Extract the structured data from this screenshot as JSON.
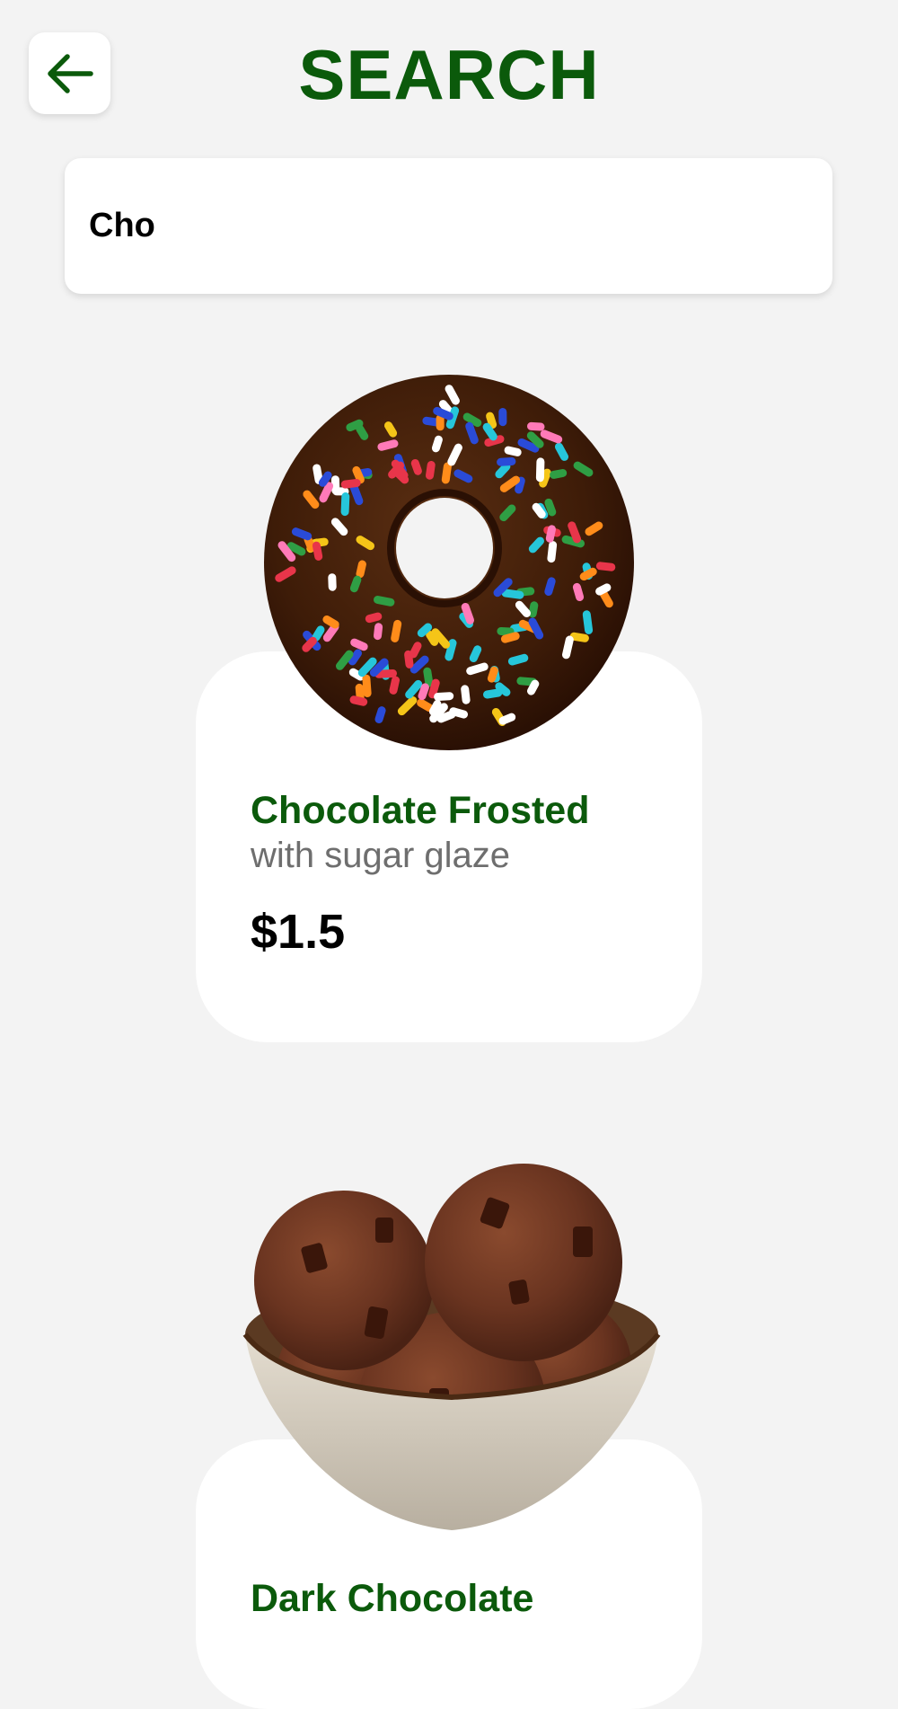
{
  "header": {
    "title": "SEARCH",
    "back_icon": "arrow-left-icon"
  },
  "search": {
    "value": "Cho"
  },
  "colors": {
    "accent": "#0b5a0b",
    "background": "#f3f3f3",
    "card": "#ffffff",
    "muted_text": "#6e6e6e"
  },
  "results": [
    {
      "name": "Chocolate Frosted",
      "description": "with sugar glaze",
      "price": "$1.5",
      "image": "chocolate-sprinkle-donut-image"
    },
    {
      "name": "Dark Chocolate",
      "image": "chocolate-ice-cream-bowl-image"
    }
  ]
}
